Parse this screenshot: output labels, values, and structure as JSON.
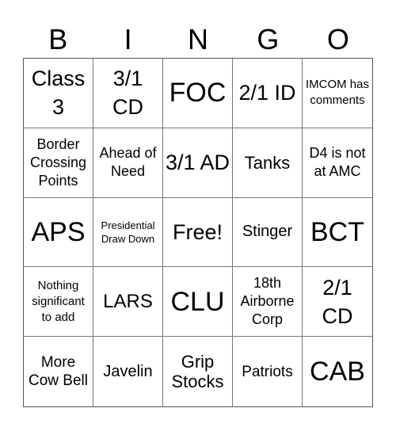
{
  "header": [
    "B",
    "I",
    "N",
    "G",
    "O"
  ],
  "cells": [
    [
      "Class 3",
      "3/1 CD",
      "FOC",
      "2/1 ID",
      "IMCOM has comments"
    ],
    [
      "Border Crossing Points",
      "Ahead of Need",
      "3/1 AD",
      "Tanks",
      "D4 is not at AMC"
    ],
    [
      "APS",
      "Presidential Draw Down",
      "Free!",
      "Stinger",
      "BCT"
    ],
    [
      "Nothing significant to add",
      "LARS",
      "CLU",
      "18th Airborne Corp",
      "2/1 CD"
    ],
    [
      "More Cow Bell",
      "Javelin",
      "Grip Stocks",
      "Patriots",
      "CAB"
    ]
  ]
}
